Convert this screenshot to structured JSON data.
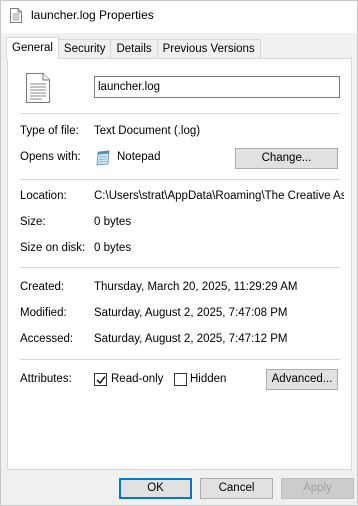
{
  "window": {
    "title": "launcher.log Properties"
  },
  "tabs": [
    {
      "label": "General",
      "active": true
    },
    {
      "label": "Security",
      "active": false
    },
    {
      "label": "Details",
      "active": false
    },
    {
      "label": "Previous Versions",
      "active": false
    }
  ],
  "general": {
    "file_name": "launcher.log",
    "type_label": "Type of file:",
    "type_value": "Text Document (.log)",
    "opens_label": "Opens with:",
    "opens_value": "Notepad",
    "change_button": "Change...",
    "location_label": "Location:",
    "location_value": "C:\\Users\\strat\\AppData\\Roaming\\The Creative Ass",
    "size_label": "Size:",
    "size_value": "0 bytes",
    "size_disk_label": "Size on disk:",
    "size_disk_value": "0 bytes",
    "created_label": "Created:",
    "created_value": "Thursday, March 20, 2025, 11:29:29 AM",
    "modified_label": "Modified:",
    "modified_value": "Saturday, August 2, 2025, 7:47:08 PM",
    "accessed_label": "Accessed:",
    "accessed_value": "Saturday, August 2, 2025, 7:47:12 PM",
    "attributes_label": "Attributes:",
    "readonly_label": "Read-only",
    "readonly_checked": true,
    "hidden_label": "Hidden",
    "hidden_checked": false,
    "advanced_button": "Advanced..."
  },
  "footer": {
    "ok": "OK",
    "cancel": "Cancel",
    "apply": "Apply"
  },
  "colors": {
    "dialog_bg": "#f0f0f0",
    "panel_bg": "#ffffff",
    "accent": "#0078d7"
  },
  "icons": {
    "title_icon": "text-file-icon",
    "file_icon": "text-file-icon",
    "opens_with_icon": "notepad-icon"
  }
}
